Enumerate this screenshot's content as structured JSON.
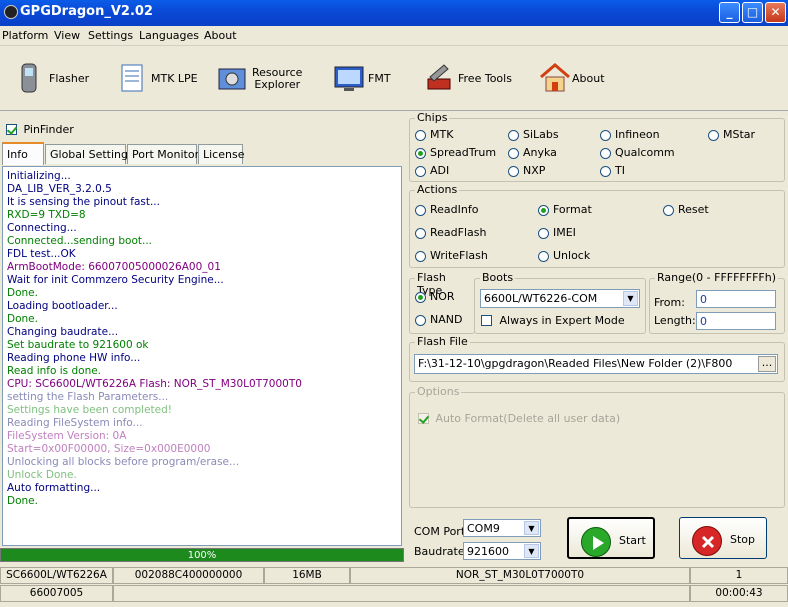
{
  "window": {
    "title": "GPGDragon_V2.02",
    "minimize": "_",
    "maximize": "□",
    "close": "✕"
  },
  "menu": [
    "Platform",
    "View",
    "Settings",
    "Languages",
    "About"
  ],
  "toolbar": [
    {
      "label": "Flasher",
      "icon": "phone-icon"
    },
    {
      "label": "MTK LPE",
      "icon": "document-icon"
    },
    {
      "label": "Resource\nExplorer",
      "icon": "film-icon"
    },
    {
      "label": "FMT",
      "icon": "monitor-icon"
    },
    {
      "label": "Free Tools",
      "icon": "tools-icon"
    },
    {
      "label": "About",
      "icon": "home-icon"
    }
  ],
  "pinfinder": {
    "label": "PinFinder",
    "checked": true
  },
  "tabs": [
    "Info",
    "Global Settings",
    "Port Monitor",
    "License"
  ],
  "log": [
    {
      "text": "Initializing...",
      "color": "#000080"
    },
    {
      "text": "DA_LIB_VER_3.2.0.5",
      "color": "#000080"
    },
    {
      "text": "It is sensing the pinout fast...",
      "color": "#000080"
    },
    {
      "text": "RXD=9  TXD=8",
      "color": "#008000"
    },
    {
      "text": "Connecting...",
      "color": "#000080"
    },
    {
      "text": "Connected...sending boot...",
      "color": "#008000"
    },
    {
      "text": "FDL test...OK",
      "color": "#000080"
    },
    {
      "text": "ArmBootMode: 66007005000026A00_01",
      "color": "#800080"
    },
    {
      "text": "Wait for init Commzero Security Engine...",
      "color": "#000080"
    },
    {
      "text": "Done.",
      "color": "#008000"
    },
    {
      "text": "Loading bootloader...",
      "color": "#000080"
    },
    {
      "text": "Done.",
      "color": "#008000"
    },
    {
      "text": "Changing baudrate...",
      "color": "#000080"
    },
    {
      "text": "Set baudrate to 921600 ok",
      "color": "#008000"
    },
    {
      "text": "Reading phone HW info...",
      "color": "#000080"
    },
    {
      "text": "Read info is done.",
      "color": "#008000"
    },
    {
      "text": "CPU: SC6600L/WT6226A      Flash: NOR_ST_M30L0T7000T0",
      "color": "#800080"
    },
    {
      "text": "setting the Flash Parameters...",
      "color": "#8a8ab8"
    },
    {
      "text": "Settings have been completed!",
      "color": "#7fc07f"
    },
    {
      "text": "Reading FileSystem info...",
      "color": "#8a8ab8"
    },
    {
      "text": "FileSystem Version: 0A",
      "color": "#c080c0"
    },
    {
      "text": "Start=0x00F00000, Size=0x000E0000",
      "color": "#c080c0"
    },
    {
      "text": "Unlocking all blocks before program/erase...",
      "color": "#8a8ab8"
    },
    {
      "text": "Unlock Done.",
      "color": "#7fc07f"
    },
    {
      "text": "Auto formatting...",
      "color": "#000080"
    },
    {
      "text": "Done.",
      "color": "#008000"
    }
  ],
  "progress": {
    "label": "100%",
    "value": 1.0
  },
  "chips": {
    "caption": "Chips",
    "options": [
      "MTK",
      "SiLabs",
      "Infineon",
      "MStar",
      "SpreadTrum",
      "Anyka",
      "Qualcomm",
      "ADI",
      "NXP",
      "TI"
    ],
    "selected": "SpreadTrum"
  },
  "actions": {
    "caption": "Actions",
    "options": [
      "ReadInfo",
      "Format",
      "Reset",
      "ReadFlash",
      "IMEI",
      "WriteFlash",
      "Unlock"
    ],
    "selected": "Format"
  },
  "flash_type": {
    "caption": "Flash Type",
    "options": [
      "NOR",
      "NAND"
    ],
    "selected": "NOR"
  },
  "boots": {
    "caption": "Boots",
    "value": "6600L/WT6226-COM",
    "expert_label": "Always in Expert Mode",
    "expert_checked": false
  },
  "range": {
    "caption": "Range(0 - FFFFFFFFh)",
    "from_label": "From:",
    "from_value": "0",
    "length_label": "Length:",
    "length_value": "0"
  },
  "flash_file": {
    "caption": "Flash File",
    "path": "F:\\31-12-10\\gpgdragon\\Readed Files\\New Folder (2)\\F800",
    "browse": "..."
  },
  "options": {
    "caption": "Options",
    "auto_format_label": "Auto Format(Delete all user data)",
    "auto_format_checked": true
  },
  "port": {
    "com_label": "COM Port",
    "com_value": "COM9",
    "baud_label": "Baudrate",
    "baud_value": "921600"
  },
  "buttons": {
    "start": "Start",
    "stop": "Stop"
  },
  "status": {
    "row1": [
      "SC6600L/WT6226A",
      "002088C400000000",
      "16MB",
      "NOR_ST_M30L0T7000T0",
      "1"
    ],
    "row2": [
      "66007005",
      "",
      "00:00:43"
    ]
  },
  "colors": {
    "accent": "#21a121",
    "titlebar": "#0a49d6"
  }
}
